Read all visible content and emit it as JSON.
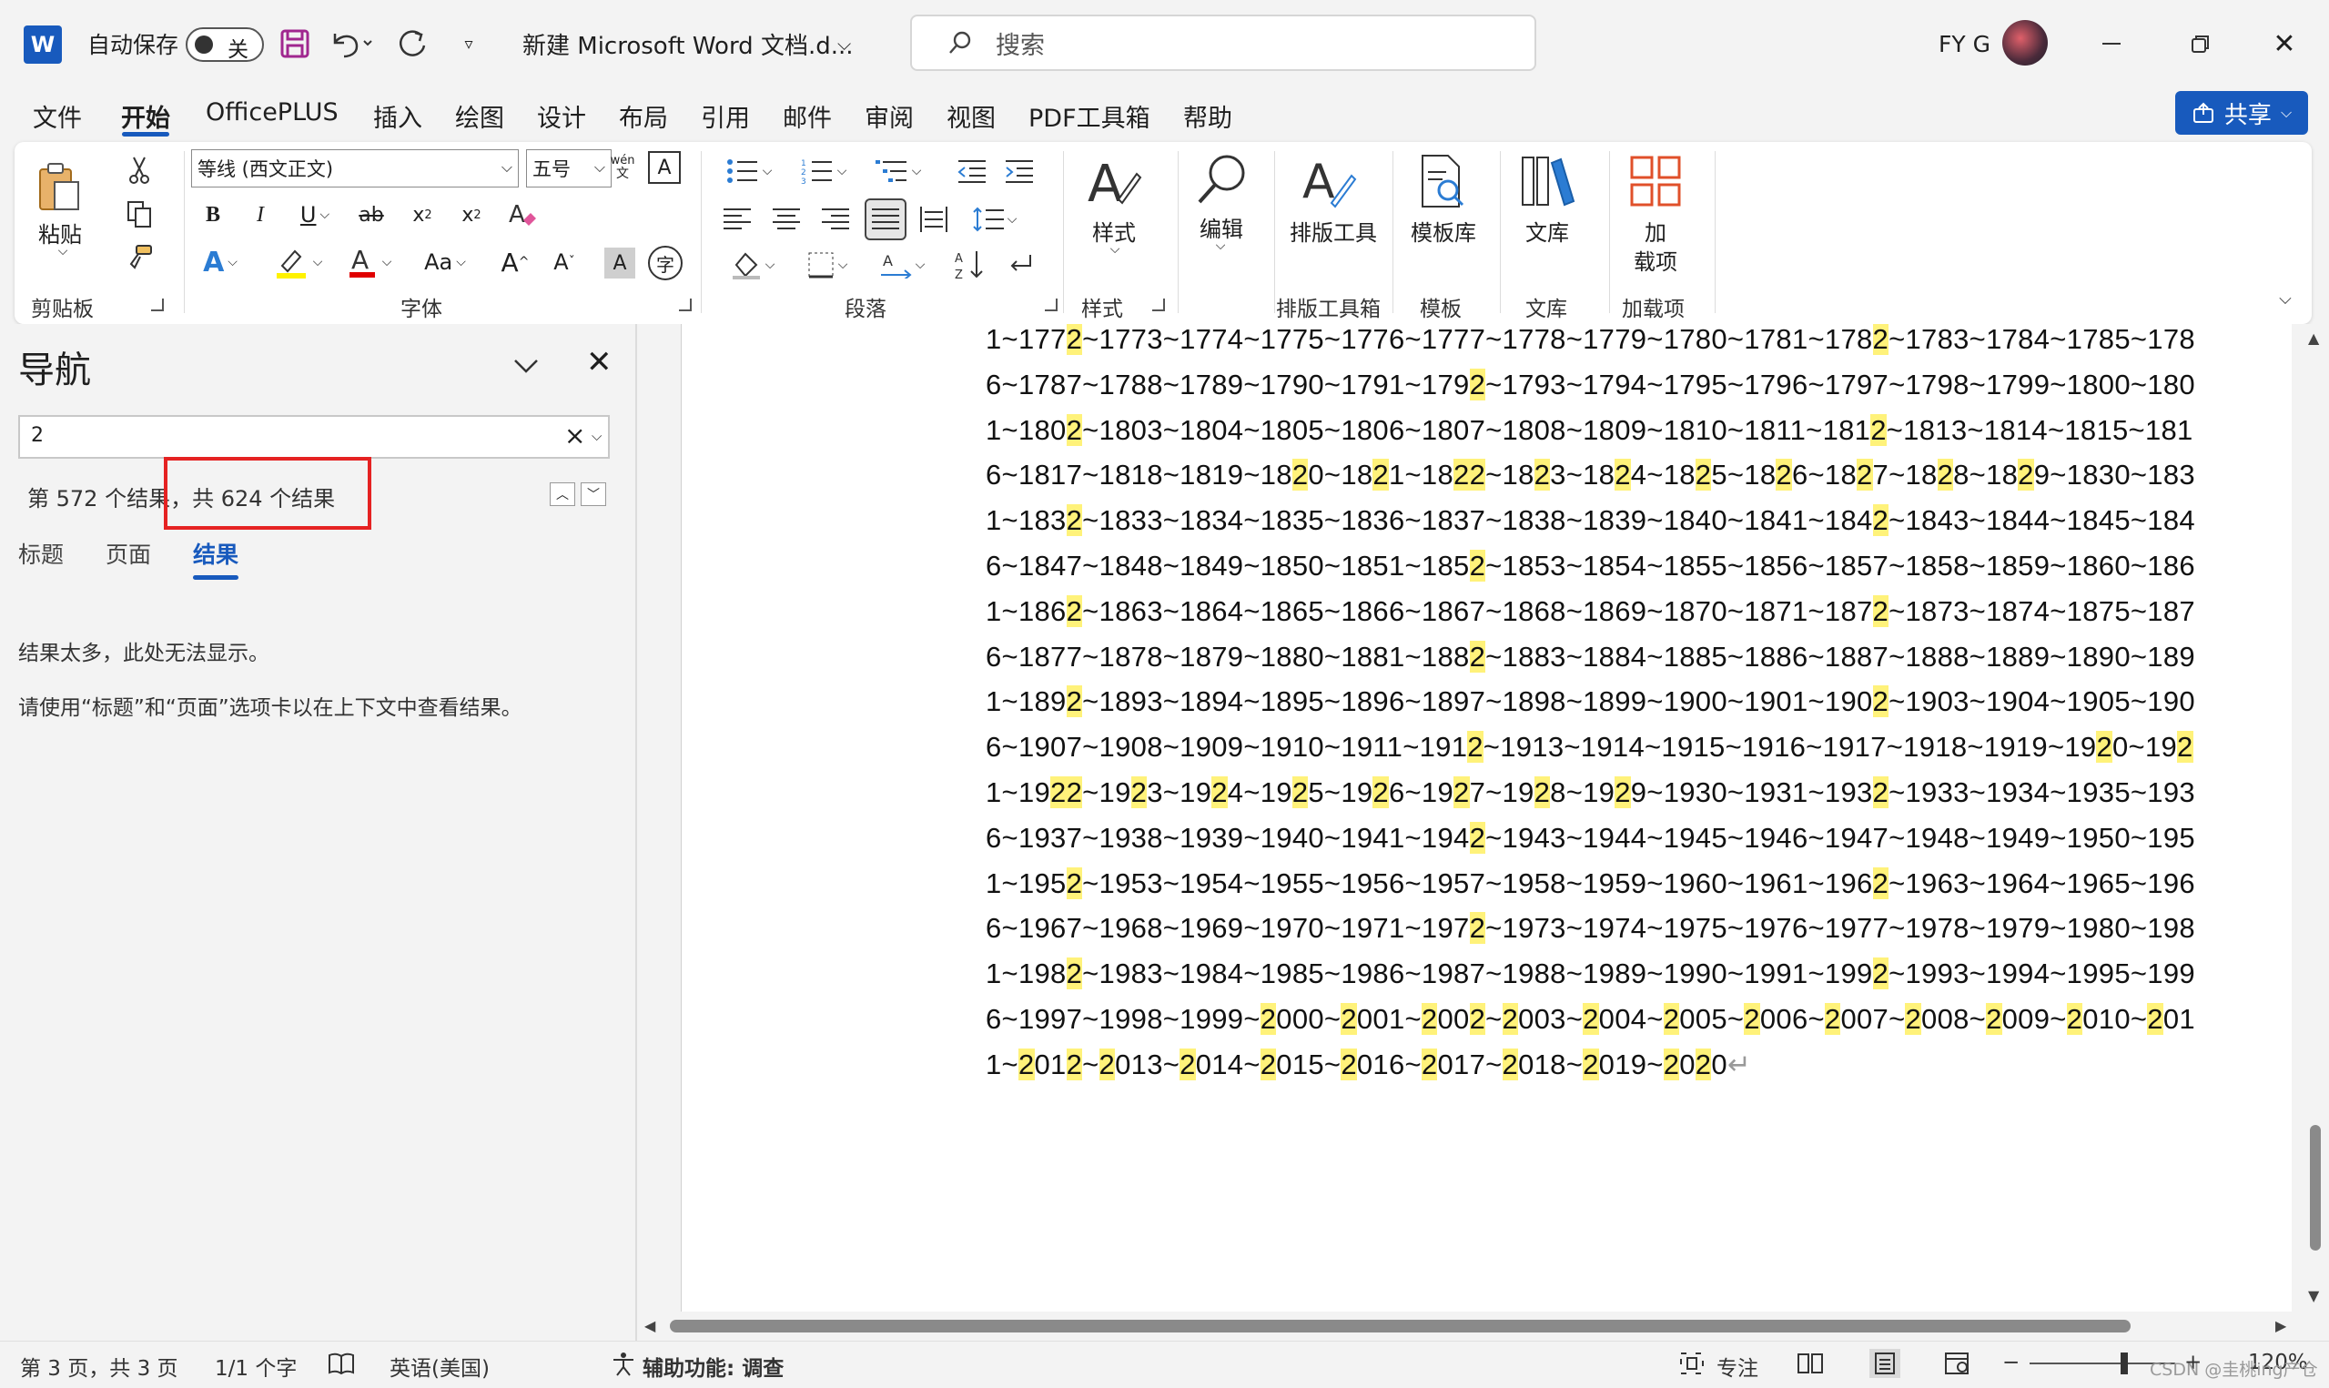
{
  "titlebar": {
    "app_logo": "W",
    "autosave_label": "自动保存",
    "autosave_state": "关",
    "doc_title": "新建 Microsoft Word 文档.d...",
    "search_placeholder": "搜索",
    "user_name": "FY G"
  },
  "menu": {
    "tabs": [
      "文件",
      "开始",
      "OfficePLUS",
      "插入",
      "绘图",
      "设计",
      "布局",
      "引用",
      "邮件",
      "审阅",
      "视图",
      "PDF工具箱",
      "帮助"
    ],
    "active_tab": "开始",
    "share_label": "共享"
  },
  "ribbon": {
    "groups": {
      "clipboard": "剪贴板",
      "font": "字体",
      "paragraph": "段落",
      "styles": "样式",
      "layout_tools": "排版工具箱",
      "templates": "模板",
      "library": "文库",
      "addins": "加载项"
    },
    "paste_label": "粘贴",
    "font_name": "等线 (西文正文)",
    "font_size": "五号",
    "phonetic_label": "wén",
    "styles_label": "样式",
    "edit_label": "编辑",
    "layout_tools_label": "排版工具",
    "template_lib_label": "模板库",
    "library_label": "文库",
    "addins_label_line1": "加",
    "addins_label_line2": "载项",
    "change_case_label": "Aa"
  },
  "nav": {
    "title": "导航",
    "search_value": "2",
    "result_count": "第 572 个结果，共 624 个结果",
    "tabs": [
      "标题",
      "页面",
      "结果"
    ],
    "active_tab": "结果",
    "message_1": "结果太多，此处无法显示。",
    "message_2": "请使用“标题”和“页面”选项卡以在上下文中查看结果。"
  },
  "document": {
    "search_term": "2",
    "highlight_color": "#fff27a",
    "first_line_prefix": "1~",
    "year_start": 1772,
    "year_end": 2020,
    "paragraph_mark": "↵"
  },
  "statusbar": {
    "page_info": "第 3 页，共 3 页",
    "word_count": "1/1 个字",
    "language": "英语(美国)",
    "accessibility": "辅助功能: 调查",
    "focus": "专注",
    "zoom": "120%",
    "watermark": "CSDN @圭桃ing产仓"
  },
  "colors": {
    "accent": "#185abd",
    "annotation_box": "#e52222"
  }
}
